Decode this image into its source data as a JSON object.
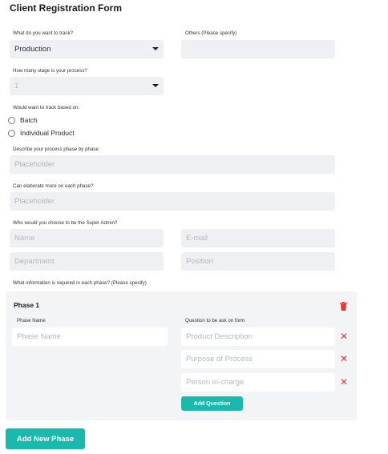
{
  "form": {
    "title": "Client Registration Form",
    "track_label": "What do you want to track?",
    "track_value": "Production",
    "others_label": "Others (Please specify)",
    "stages_label": "How many stage is your process?",
    "stages_value": "1",
    "track_based_label": "Would want to track based on:",
    "radio_options": [
      "Batch",
      "Individual Product"
    ],
    "describe_label": "Describe your process phase by phase",
    "describe_placeholder": "Placeholder",
    "elaborate_label": "Can elaborate more on each phase?",
    "elaborate_placeholder": "Placeholder",
    "super_admin_label": "Who would you choose to be the Super Admin?",
    "name_placeholder": "Name",
    "email_placeholder": "E-mail",
    "department_placeholder": "Department",
    "position_placeholder": "Position",
    "info_required_label": "What information is required in each phase? (Please specify)"
  },
  "phase": {
    "title": "Phase 1",
    "phase_name_label": "Phase Name",
    "phase_name_placeholder": "Phase Name",
    "question_label": "Question to be ask on form",
    "questions": [
      "Product Description",
      "Purpose of Process",
      "Person in-charge"
    ],
    "add_question_label": "Add Question"
  },
  "add_phase_label": "Add New Phase",
  "colors": {
    "accent": "#19b9ad",
    "delete": "#e53935",
    "field_bg": "#eef0f3",
    "phase_bg": "#f3f4f6"
  },
  "icons": {
    "trash": "trash-icon",
    "remove": "close-icon",
    "dropdown": "chevron-down-icon"
  }
}
